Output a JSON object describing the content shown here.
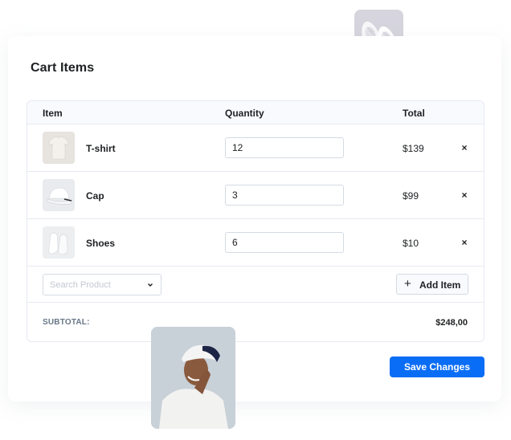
{
  "cart": {
    "title": "Cart Items",
    "columns": {
      "item": "Item",
      "quantity": "Quantity",
      "total": "Total"
    },
    "items": [
      {
        "name": "T-shirt",
        "quantity": "12",
        "total": "$139",
        "remove_icon": "×",
        "thumb": "tshirt-image"
      },
      {
        "name": "Cap",
        "quantity": "3",
        "total": "$99",
        "remove_icon": "×",
        "thumb": "cap-image"
      },
      {
        "name": "Shoes",
        "quantity": "6",
        "total": "$10",
        "remove_icon": "×",
        "thumb": "shoes-image"
      }
    ],
    "search": {
      "placeholder": "Search Product"
    },
    "add_item": {
      "icon": "+",
      "label": "Add Item"
    },
    "subtotal": {
      "label": "SUBTOTAL:",
      "value": "$248,00"
    },
    "save_label": "Save Changes"
  },
  "colors": {
    "primary": "#0a6df5",
    "border": "#e7eaf3",
    "header_bg": "#f8fafd",
    "text": "#1e2022",
    "muted": "#677788"
  }
}
